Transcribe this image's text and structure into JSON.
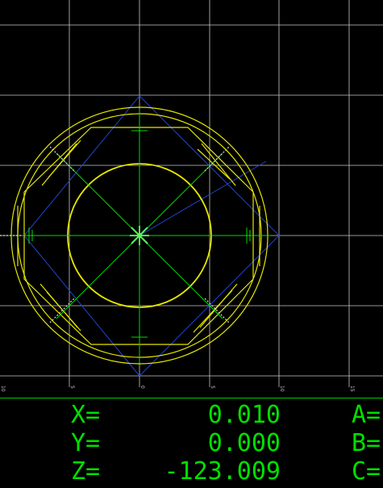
{
  "plot": {
    "grid_color": "#c8c8c8",
    "toolpath_color": "#00dd00",
    "geometry_color": "#e6e600",
    "rapid_color": "#2244cc",
    "axis_ticks": [
      "10",
      "5",
      "0",
      "5",
      "10",
      "15"
    ]
  },
  "dro": {
    "color": "#00e000",
    "rows": [
      {
        "axis": "X=",
        "value": "0.010",
        "aux": "A="
      },
      {
        "axis": "Y=",
        "value": "0.000",
        "aux": "B="
      },
      {
        "axis": "Z=",
        "value": "-123.009",
        "aux": "C="
      }
    ]
  }
}
